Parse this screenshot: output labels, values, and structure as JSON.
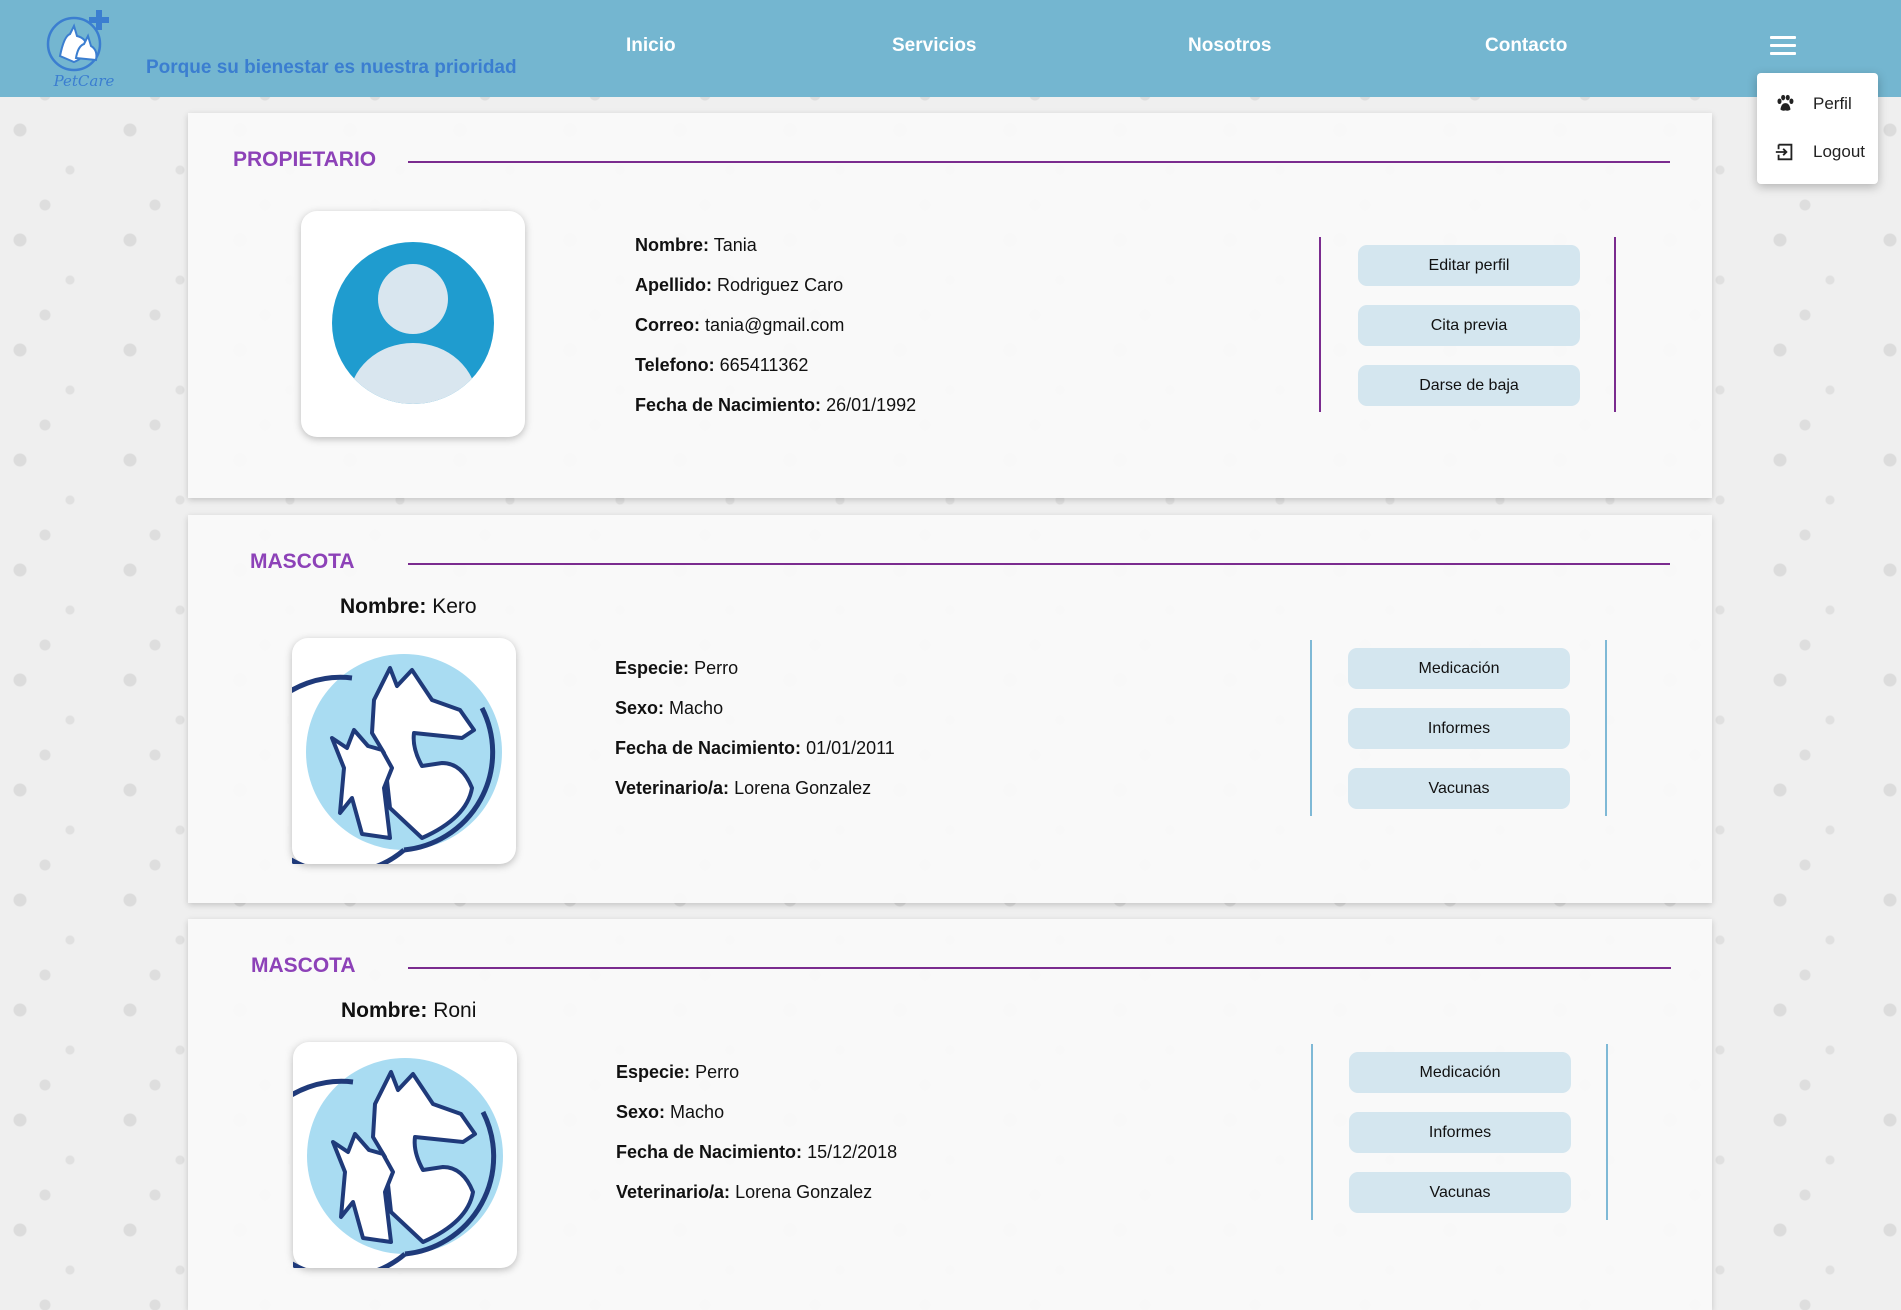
{
  "header": {
    "logo_text": "PetCare",
    "slogan": "Porque su bienestar es nuestra prioridad",
    "nav": [
      "Inicio",
      "Servicios",
      "Nosotros",
      "Contacto"
    ],
    "menu_icon": "hamburger-menu-icon"
  },
  "dropdown": {
    "items": [
      {
        "label": "Perfil",
        "icon": "paw-icon"
      },
      {
        "label": "Logout",
        "icon": "logout-icon"
      }
    ]
  },
  "owner": {
    "section_title": "PROPIETARIO",
    "fields": [
      {
        "label": "Nombre:",
        "value": "Tania"
      },
      {
        "label": "Apellido:",
        "value": "Rodriguez Caro"
      },
      {
        "label": "Correo:",
        "value": "tania@gmail.com"
      },
      {
        "label": "Telefono:",
        "value": "665411362"
      },
      {
        "label": "Fecha de Nacimiento:",
        "value": "26/01/1992"
      }
    ],
    "buttons": [
      "Editar perfil",
      "Cita previa",
      "Darse de baja"
    ],
    "accent_line": "#7b2c8f"
  },
  "pets": [
    {
      "section_title": "MASCOTA",
      "name_label": "Nombre:",
      "name": "Kero",
      "fields": [
        {
          "label": "Especie:",
          "value": "Perro"
        },
        {
          "label": "Sexo:",
          "value": "Macho"
        },
        {
          "label": "Fecha de Nacimiento:",
          "value": "01/01/2011"
        },
        {
          "label": "Veterinario/a:",
          "value": "Lorena Gonzalez"
        }
      ],
      "buttons": [
        "Medicación",
        "Informes",
        "Vacunas"
      ]
    },
    {
      "section_title": "MASCOTA",
      "name_label": "Nombre:",
      "name": "Roni",
      "fields": [
        {
          "label": "Especie:",
          "value": "Perro"
        },
        {
          "label": "Sexo:",
          "value": "Macho"
        },
        {
          "label": "Fecha de Nacimiento:",
          "value": "15/12/2018"
        },
        {
          "label": "Veterinario/a:",
          "value": "Lorena Gonzalez"
        }
      ],
      "buttons": [
        "Medicación",
        "Informes",
        "Vacunas"
      ]
    }
  ],
  "colors": {
    "header_bg": "#74b6d0",
    "title_purple": "#8d42b8",
    "divider_blue": "#7fb9d6",
    "button_bg": "#d4e6ef"
  }
}
